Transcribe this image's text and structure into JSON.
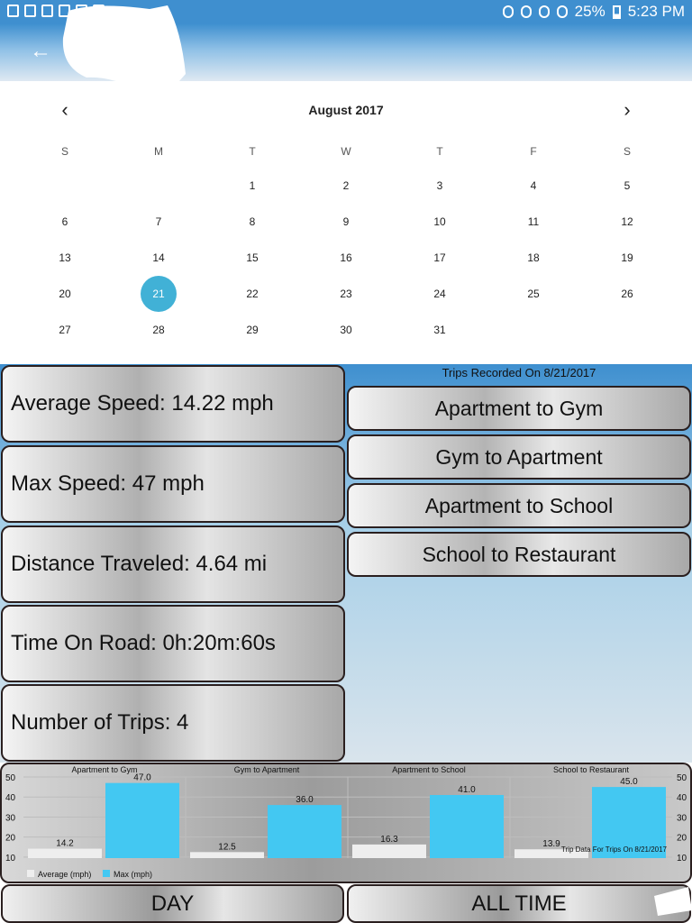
{
  "status_bar": {
    "battery": "25%",
    "time": "5:23 PM",
    "left_icons": [
      "youtube-icon",
      "accessibility-icon",
      "image-icon",
      "settings-dial-icon",
      "flipboard-icon",
      "play-store-icon"
    ],
    "right_icons": [
      "location-icon",
      "mute-icon",
      "alarm-icon",
      "wifi-icon",
      "battery-icon"
    ]
  },
  "app_bar": {
    "back_icon": "back-arrow-icon"
  },
  "calendar": {
    "month_title": "August 2017",
    "weekdays": [
      "S",
      "M",
      "T",
      "W",
      "T",
      "F",
      "S"
    ],
    "start_offset": 2,
    "days_in_month": 31,
    "selected_day": 21,
    "prev_icon": "chevron-left-icon",
    "next_icon": "chevron-right-icon"
  },
  "stats": [
    {
      "label": "Average Speed: 14.22 mph"
    },
    {
      "label": "Max Speed: 47 mph"
    },
    {
      "label": "Distance Traveled: 4.64 mi"
    },
    {
      "label": "Time On Road:  0h:20m:60s"
    },
    {
      "label": "Number of Trips: 4"
    }
  ],
  "trips": {
    "title": "Trips Recorded On 8/21/2017",
    "items": [
      "Apartment to Gym",
      "Gym to Apartment",
      "Apartment to School",
      "School to Restaurant"
    ]
  },
  "chart_data": {
    "type": "bar",
    "categories": [
      "Apartment to Gym",
      "Gym to Apartment",
      "Apartment to School",
      "School to Restaurant"
    ],
    "series": [
      {
        "name": "Average (mph)",
        "values": [
          14.2,
          12.5,
          16.3,
          13.9
        ],
        "color": "#eeeeee"
      },
      {
        "name": "Max (mph)",
        "values": [
          47.0,
          36.0,
          41.0,
          45.0
        ],
        "color": "#43c8f2"
      }
    ],
    "value_labels": [
      [
        "14.2",
        "12.5",
        "16.3",
        "13.9"
      ],
      [
        "47.0",
        "36.0",
        "41.0",
        "45.0"
      ]
    ],
    "yticks": [
      "10",
      "20",
      "30",
      "40",
      "50"
    ],
    "ylim": [
      9.5,
      50
    ],
    "description": "Trip Data For Trips On 8/21/2017",
    "legend_position": "bottom-left"
  },
  "buttons": {
    "day": "DAY",
    "all_time": "ALL TIME"
  }
}
